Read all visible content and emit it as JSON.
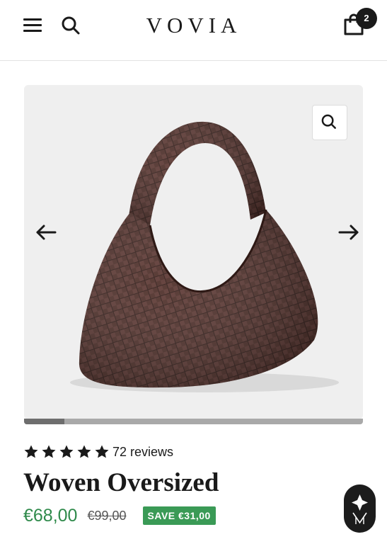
{
  "header": {
    "logo": "VOVIA",
    "cart_count": "2",
    "icons": [
      "hamburger-menu-icon",
      "search-icon",
      "shopping-bag-icon"
    ]
  },
  "gallery": {
    "image_alt": "Woven oversized hobo bag in dark brown",
    "slide_progress": 0.12,
    "icons": [
      "zoom-icon",
      "arrow-left-icon",
      "arrow-right-icon"
    ]
  },
  "product": {
    "rating": 5,
    "reviews_label": "72 reviews",
    "title": "Woven Oversized",
    "price": "€68,00",
    "compare_price": "€99,00",
    "save_label": "SAVE €31,00"
  },
  "colors": {
    "price_green": "#2f8a4b",
    "badge_green": "#3a9a56",
    "text_dark": "#1a1a1a",
    "bag_brown": "#4a2a24"
  },
  "chat_widget": {
    "icon": "brand-emblem-icon"
  }
}
